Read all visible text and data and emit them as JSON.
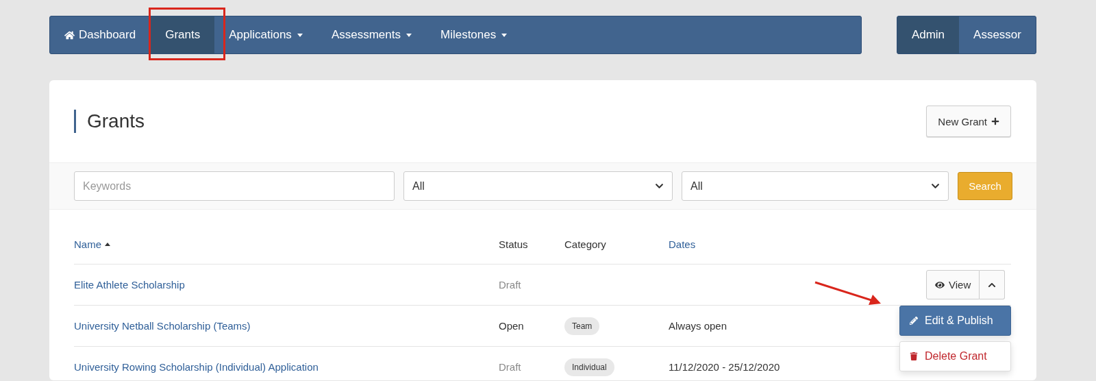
{
  "nav": {
    "items": [
      {
        "label": "Dashboard",
        "kind": "home",
        "dropdown": false,
        "selected": false
      },
      {
        "label": "Grants",
        "kind": "plain",
        "dropdown": false,
        "selected": true
      },
      {
        "label": "Applications",
        "kind": "plain",
        "dropdown": true,
        "selected": false
      },
      {
        "label": "Assessments",
        "kind": "plain",
        "dropdown": true,
        "selected": false
      },
      {
        "label": "Milestones",
        "kind": "plain",
        "dropdown": true,
        "selected": false
      }
    ],
    "roles": [
      {
        "label": "Admin",
        "selected": true
      },
      {
        "label": "Assessor",
        "selected": false
      }
    ]
  },
  "page": {
    "title": "Grants",
    "new_button": "New Grant"
  },
  "filters": {
    "keywords": {
      "placeholder": "Keywords"
    },
    "selects": [
      "All",
      "All"
    ],
    "search_button": "Search"
  },
  "table": {
    "columns": [
      {
        "label": "Name",
        "kind": "sortable",
        "sorted": true
      },
      {
        "label": "Status",
        "kind": "plain",
        "sorted": false
      },
      {
        "label": "Category",
        "kind": "plain",
        "sorted": false
      },
      {
        "label": "Dates",
        "kind": "sortable",
        "sorted": false
      }
    ],
    "rows": [
      {
        "name": "Elite Athlete Scholarship",
        "status": "Draft",
        "muted": true,
        "view": "View",
        "menu_open": true
      },
      {
        "name": "University Netball Scholarship (Teams)",
        "status": "Open",
        "muted": false,
        "category": "Team",
        "dates": "Always open"
      },
      {
        "name": "University Rowing Scholarship (Individual) Application",
        "status": "Draft",
        "muted": true,
        "category": "Individual",
        "dates": "11/12/2020 - 25/12/2020"
      }
    ]
  },
  "row_menu": [
    "Edit & Publish",
    "Delete Grant"
  ]
}
